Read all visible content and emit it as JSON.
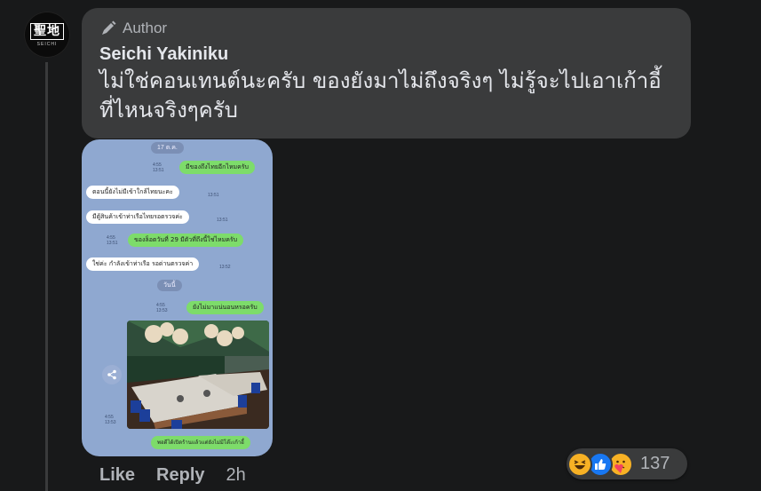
{
  "avatar": {
    "logo_text": "聖地",
    "logo_sub": "SEICHI"
  },
  "comment": {
    "badge": "Author",
    "name": "Seichi Yakiniku",
    "text_line1": "ไม่ใช่คอนเทนต์นะครับ ของยังมาไม่ถึงจริงๆ ไม่รู้จะไปเอาเก้าอี้",
    "text_line2": "ที่ไหนจริงๆครับ"
  },
  "chat_image": {
    "top_time": "17 ต.ค.",
    "messages": [
      {
        "side": "right",
        "text": "มีของถึงไทยอีกไหมครับ"
      },
      {
        "side": "left",
        "text": "ตอนนี้ยังไม่มีเข้าใกล้ไทยนะคะ"
      },
      {
        "side": "left",
        "text": "มีตู้สินค้าเข้าท่าเรือไทยรอตรวจค่ะ"
      },
      {
        "side": "right",
        "text": "ของล็อตวันที่ 29 มีตัวที่ถึงนี้ใช่ไหมครับ"
      },
      {
        "side": "left",
        "text": "ใช่ค่ะ กำลังเข้าท่าเรือ รอด่านตรวจค่า"
      },
      {
        "side": "right",
        "text": "ยังไม่มาแน่นอนหรอครับ"
      },
      {
        "side": "right",
        "text": "พอดีได้เปิดร้านแล้วแต่ยังไม่มีโต๊ะเก้าอี้"
      }
    ],
    "date_label": "วันนี้"
  },
  "actions": {
    "like": "Like",
    "reply": "Reply",
    "time": "2h"
  },
  "reactions": {
    "count": "137"
  },
  "icons": [
    "pen-icon",
    "share-icon",
    "haha-reaction-icon",
    "like-reaction-icon",
    "care-reaction-icon"
  ],
  "colors": {
    "background": "#18191a",
    "bubble": "#3a3b3c",
    "text": "#e4e6eb",
    "secondary": "#b0b3b8",
    "like_blue": "#1877f2"
  }
}
